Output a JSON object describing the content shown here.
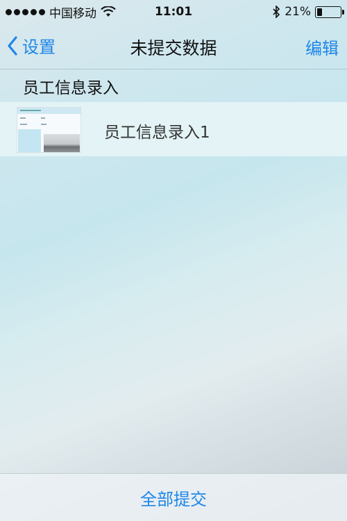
{
  "status_bar": {
    "carrier": "中国移动",
    "time": "11:01",
    "battery_percent": "21%",
    "battery_level": 0.21,
    "icons": [
      "signal-dots",
      "wifi-icon",
      "bluetooth-icon",
      "battery-icon"
    ]
  },
  "nav": {
    "back_label": "设置",
    "title": "未提交数据",
    "edit_label": "编辑"
  },
  "section": {
    "header": "员工信息录入"
  },
  "items": [
    {
      "label": "员工信息录入1"
    }
  ],
  "bottom": {
    "submit_all_label": "全部提交"
  },
  "colors": {
    "accent": "#1e86e8",
    "text": "#111111"
  }
}
